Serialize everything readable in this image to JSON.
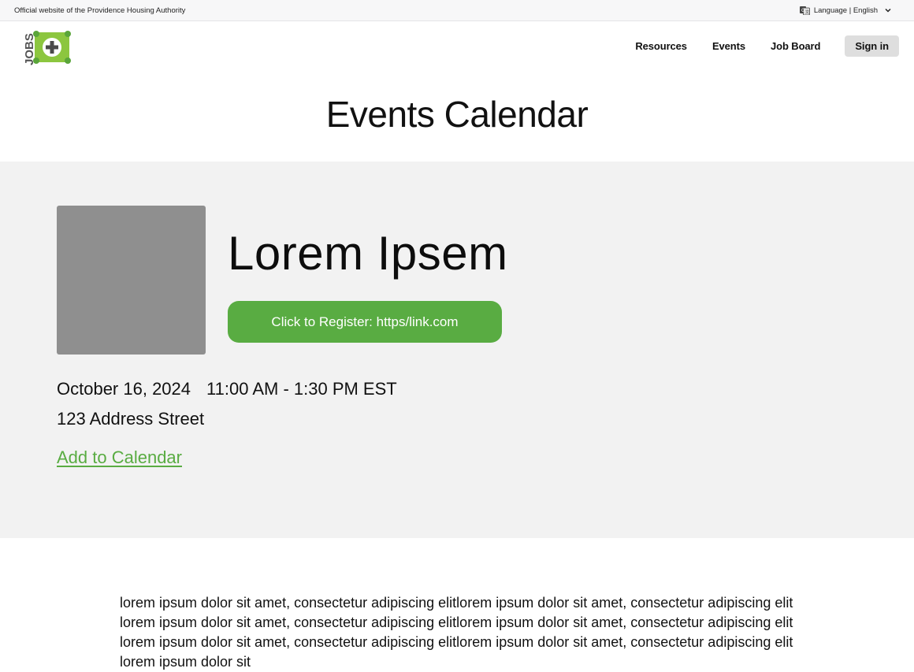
{
  "utility_bar": {
    "official_text": "Official website of the Providence Housing Authority",
    "language_label": "Language | English"
  },
  "header": {
    "logo_text": "JOBS",
    "nav": {
      "resources": "Resources",
      "events": "Events",
      "job_board": "Job Board",
      "sign_in": "Sign in"
    }
  },
  "page": {
    "title": "Events Calendar"
  },
  "event": {
    "title": "Lorem Ipsem",
    "register_label": "Click to Register: https/link.com",
    "date": "October 16, 2024",
    "time": "11:00 AM - 1:30 PM EST",
    "address": "123 Address Street",
    "add_to_calendar": "Add to Calendar",
    "description": "lorem ipsum dolor sit amet, consectetur adipiscing elitlorem ipsum dolor sit amet, consectetur adipiscing elit lorem ipsum dolor sit amet, consectetur adipiscing elitlorem ipsum dolor sit amet, consectetur adipiscing elit lorem ipsum dolor sit amet, consectetur adipiscing elitlorem ipsum dolor sit amet, consectetur adipiscing elit lorem ipsum dolor sit"
  },
  "colors": {
    "brand_green": "#59ac42",
    "hero_background": "#f2f2f2",
    "image_placeholder": "#8f8f8f",
    "signin_background": "#dedede"
  },
  "icons": {
    "translate": "translate-icon",
    "chevron": "chevron-down-icon",
    "logo": "jobs-plus-logo"
  }
}
